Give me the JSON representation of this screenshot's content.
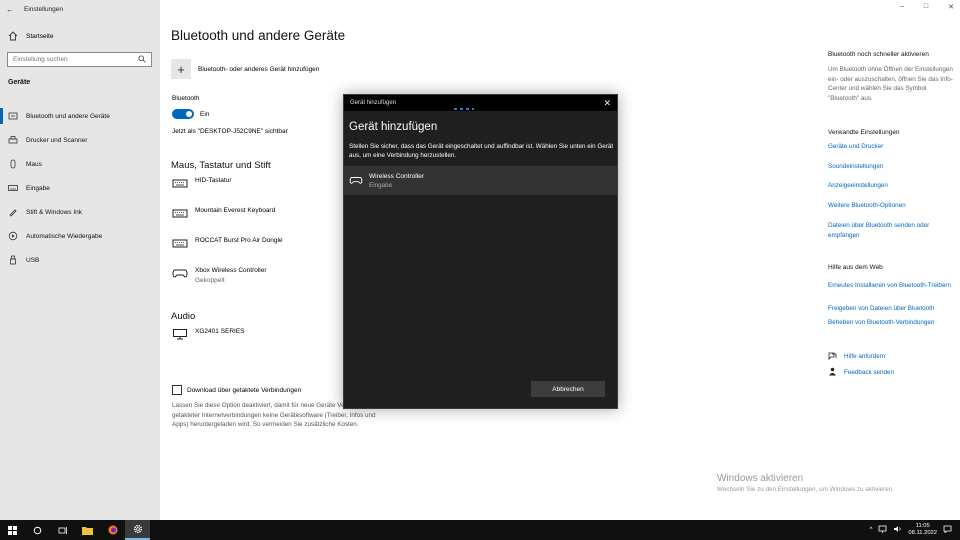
{
  "app": {
    "title": "Einstellungen"
  },
  "sidebar": {
    "home": "Startseite",
    "search_placeholder": "Einstellung suchen",
    "section": "Geräte",
    "items": [
      {
        "label": "Bluetooth und andere Geräte",
        "icon": "bluetooth-icon",
        "active": true
      },
      {
        "label": "Drucker und Scanner",
        "icon": "printer-icon"
      },
      {
        "label": "Maus",
        "icon": "mouse-icon"
      },
      {
        "label": "Eingabe",
        "icon": "keyboard-icon"
      },
      {
        "label": "Stift & Windows Ink",
        "icon": "pen-icon"
      },
      {
        "label": "Automatische Wiedergabe",
        "icon": "autoplay-icon"
      },
      {
        "label": "USB",
        "icon": "usb-icon"
      }
    ]
  },
  "main": {
    "title": "Bluetooth und andere Geräte",
    "add_device": "Bluetooth- oder anderes Gerät hinzufügen",
    "bluetooth_label": "Bluetooth",
    "toggle_state": "Ein",
    "visible_as": "Jetzt als \"DESKTOP-J52C9NE\" sichtbar",
    "group_input": "Maus, Tastatur und Stift",
    "devices_input": [
      {
        "name": "HID-Tastatur",
        "status": ""
      },
      {
        "name": "Mountain Everest Keyboard",
        "status": ""
      },
      {
        "name": "ROCCAT Burst Pro Air Dongle",
        "status": ""
      },
      {
        "name": "Xbox Wireless Controller",
        "status": "Gekoppelt"
      }
    ],
    "group_audio": "Audio",
    "devices_audio": [
      {
        "name": "XG2401 SERIES"
      }
    ],
    "metered_label": "Download über getaktete Verbindungen",
    "metered_desc": "Lassen Sie diese Option deaktiviert, damit für neue Geräte Verwendung getakteter Internetverbindungen keine Gerätesoftware (Treiber, Infos und Apps) heruntergeladen wird. So vermeiden Sie zusätzliche Kosten."
  },
  "right": {
    "fast_title": "Bluetooth noch schneller aktivieren",
    "fast_text": "Um Bluetooth ohne Öffnen der Einstellungen ein- oder auszuschalten, öffnen Sie das Info-Center und wählen Sie das Symbol \"Bluetooth\" aus.",
    "related_title": "Verwandte Einstellungen",
    "related_links": [
      "Geräte und Drucker",
      "Soundeinstellungen",
      "Anzeigeeinstellungen",
      "Weitere Bluetooth-Optionen",
      "Dateien über Bluetooth senden oder empfangen"
    ],
    "web_title": "Hilfe aus dem Web",
    "web_links": [
      "Erneutes Installieren von Bluetooth-Treibern",
      "Freigeben von Dateien über Bluetooth",
      "Beheben von Bluetooth-Verbindungen"
    ],
    "help": "Hilfe anfordern",
    "feedback": "Feedback senden"
  },
  "activation": {
    "title": "Windows aktivieren",
    "text": "Wechseln Sie zu den Einstellungen, um Windows zu aktivieren."
  },
  "dialog": {
    "bar_title": "Gerät hinzufügen",
    "title": "Gerät hinzufügen",
    "description": "Stellen Sie sicher, dass das Gerät eingeschaltet und auffindbar ist. Wählen Sie unten ein Gerät aus, um eine Verbindung herzustellen.",
    "device_name": "Wireless Controller",
    "device_type": "Eingabe",
    "cancel": "Abbrechen"
  },
  "taskbar": {
    "time": "11:05",
    "date": "08.11.2022"
  },
  "colors": {
    "accent": "#0067c0",
    "dialog_bg": "#1f1f1f",
    "taskbar": "#101010"
  }
}
